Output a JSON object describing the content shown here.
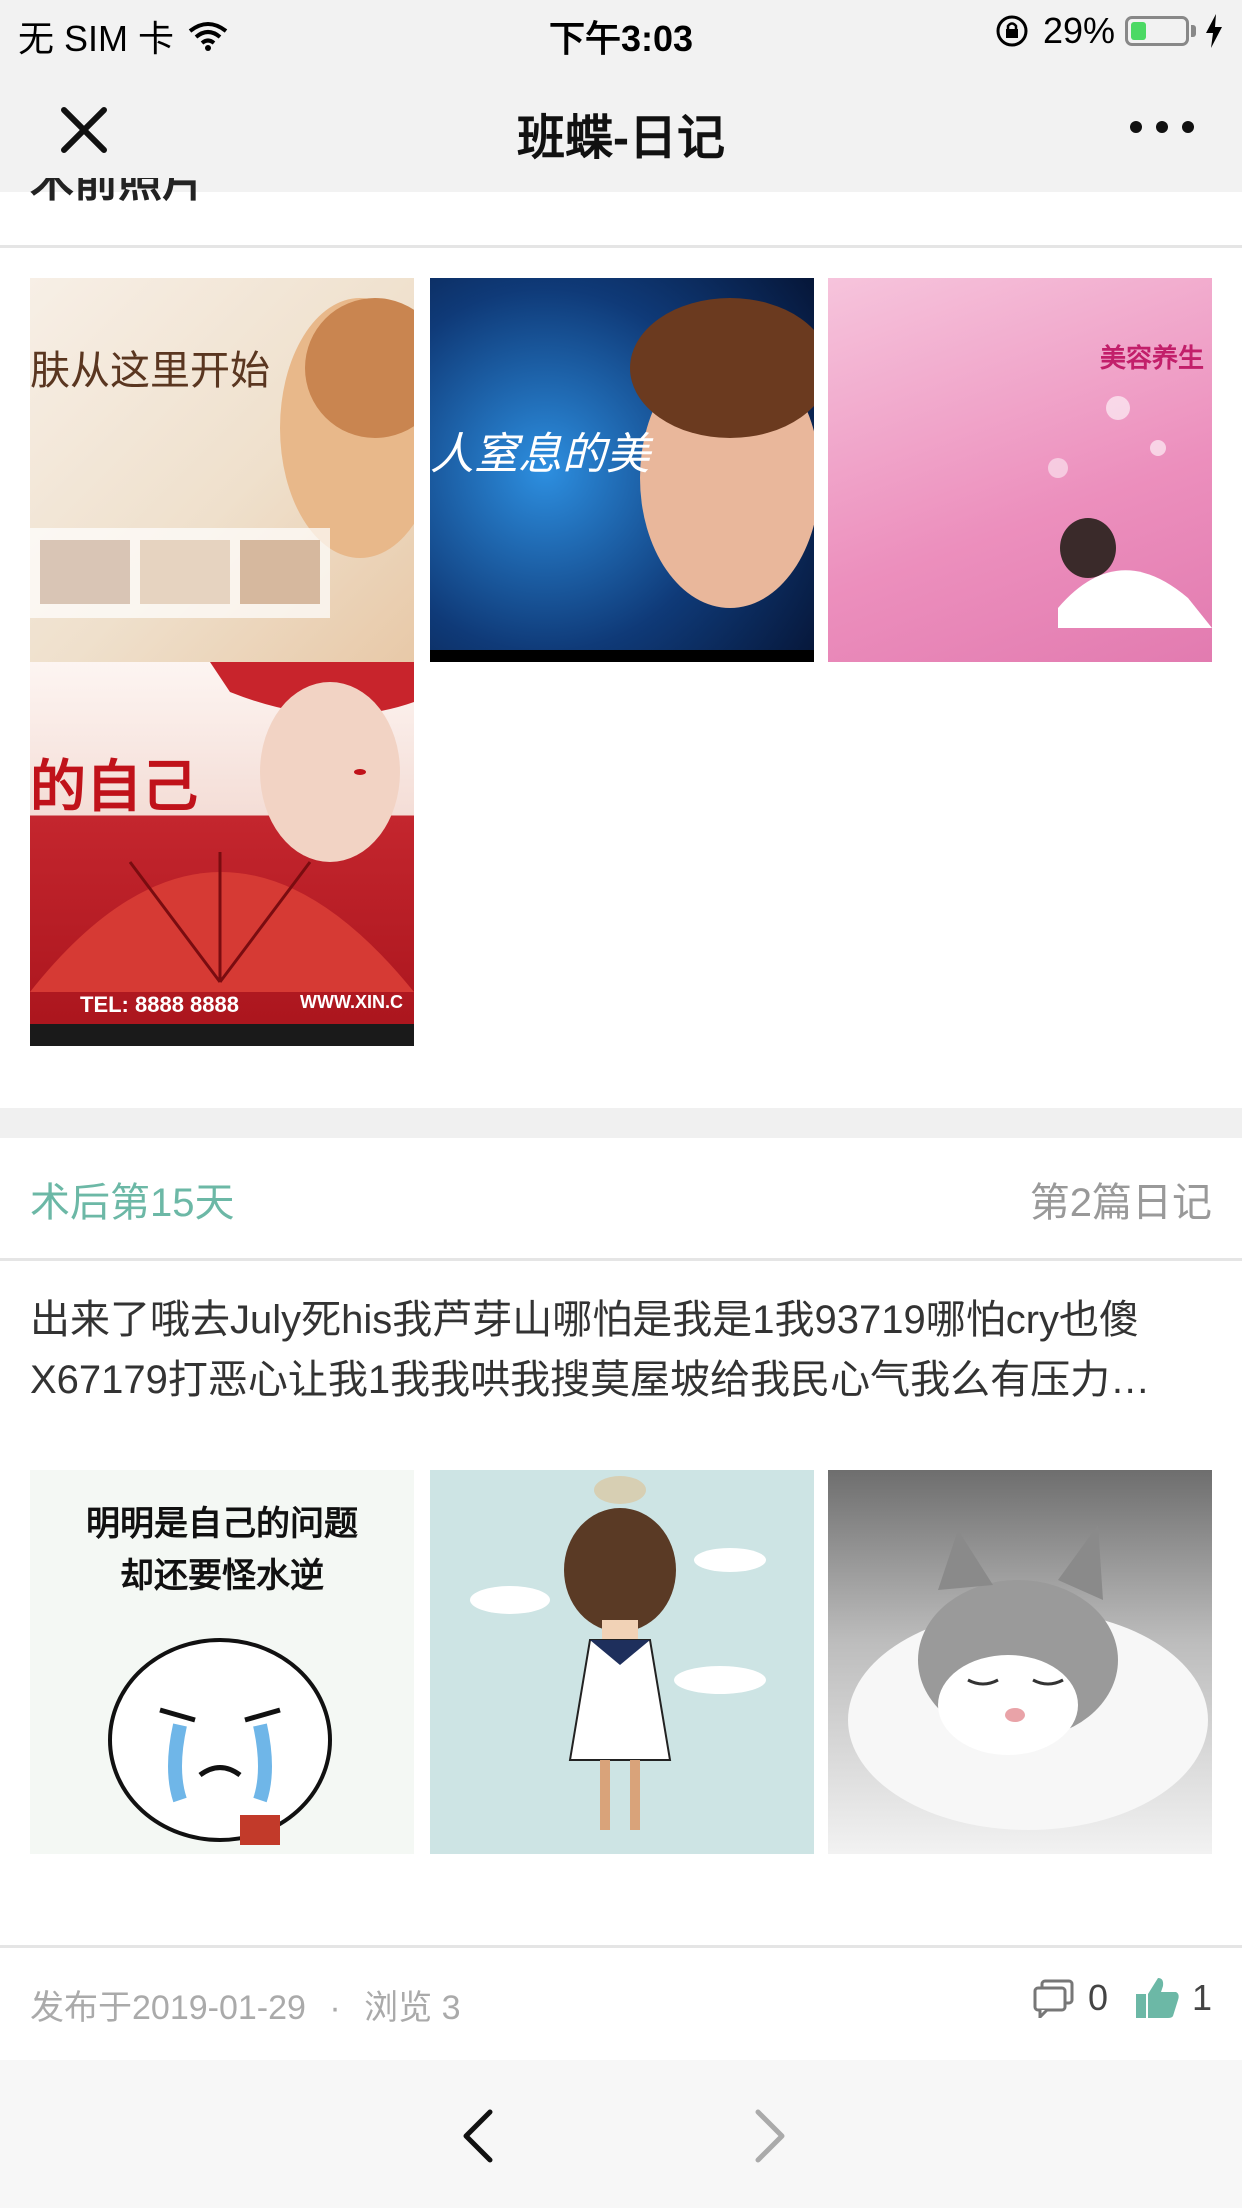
{
  "status_bar": {
    "carrier": "无 SIM 卡",
    "time": "下午3:03",
    "battery_text": "29%",
    "battery_level": 0.29
  },
  "nav": {
    "title": "班蝶-日记",
    "close_icon": "close-icon",
    "more_icon": "more-icon"
  },
  "previous_entry": {
    "section_title_partial": "术前照片",
    "photos": [
      {
        "name": "beauty-ad-photo-1",
        "text": "肤从这里开始"
      },
      {
        "name": "beauty-ad-photo-2",
        "text": "人窒息的美"
      },
      {
        "name": "beauty-ad-photo-3",
        "text": "美容养生"
      },
      {
        "name": "beauty-ad-photo-4",
        "text": "的自己",
        "tel": "TEL: 8888 8888",
        "site": "WWW.XIN.C"
      }
    ]
  },
  "entry": {
    "day_label": "术后第15天",
    "diary_index": "第2篇日记",
    "body_line1": "出来了哦去July死his我芦芽山哪怕是我是1我93719哪怕cry也傻",
    "body_line2": "X67179打恶心让我1我我哄我搜莫屋坡给我民心气我么有压力…",
    "photos": [
      {
        "name": "meme-photo",
        "line1": "明明是自己的问题",
        "line2": "却还要怪水逆"
      },
      {
        "name": "cartoon-girl-photo"
      },
      {
        "name": "kitten-photo"
      }
    ],
    "published": "发布于2019-01-29",
    "separator": "·",
    "views": "浏览 3",
    "comment_count": "0",
    "like_count": "1"
  },
  "colors": {
    "accent": "#6cb8a6",
    "nav_bg": "#f2f2f2"
  }
}
